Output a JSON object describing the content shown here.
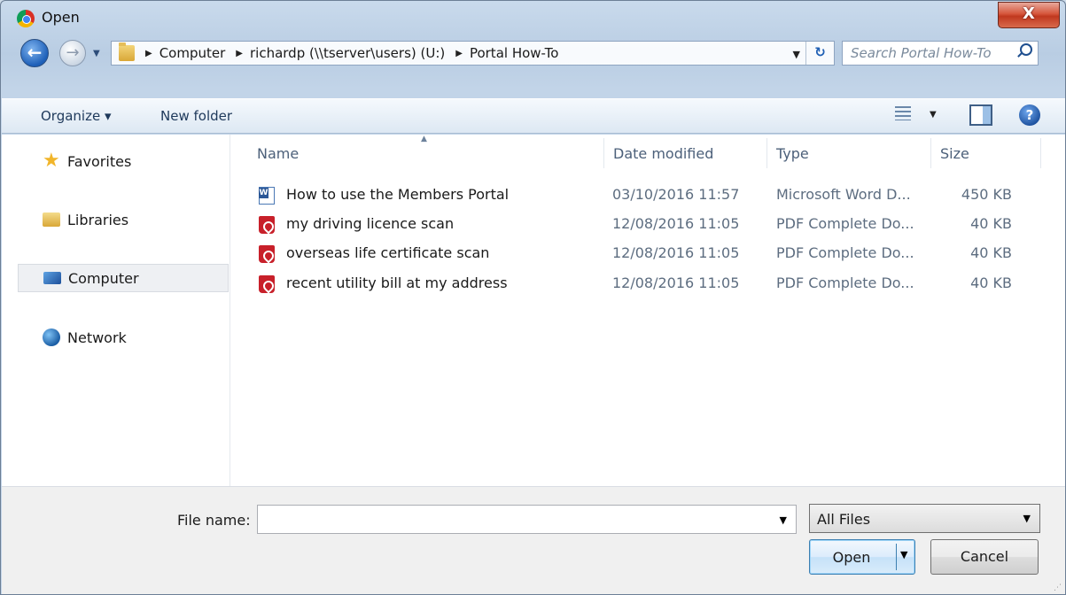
{
  "window": {
    "title": "Open",
    "close_label": "X"
  },
  "navigation": {
    "back_label": "←",
    "forward_label": "→"
  },
  "address": {
    "crumbs": [
      "Computer",
      "richardp (\\\\tserver\\users) (U:)",
      "Portal How-To"
    ],
    "refresh_label": "↻"
  },
  "search": {
    "placeholder": "Search Portal How-To"
  },
  "toolbar": {
    "organize_label": "Organize ▾",
    "new_folder_label": "New folder",
    "help_label": "?"
  },
  "sidebar": {
    "items": [
      {
        "label": "Favorites",
        "icon": "star-icon"
      },
      {
        "label": "Libraries",
        "icon": "libraries-icon"
      },
      {
        "label": "Computer",
        "icon": "computer-icon",
        "selected": true
      },
      {
        "label": "Network",
        "icon": "network-icon"
      }
    ]
  },
  "files": {
    "columns": [
      "Name",
      "Date modified",
      "Type",
      "Size"
    ],
    "sort_indicator": "▲",
    "rows": [
      {
        "name": "How to use the Members Portal",
        "date": "03/10/2016 11:57",
        "type": "Microsoft Word D...",
        "size": "450 KB",
        "icon": "word-document-icon"
      },
      {
        "name": "my driving licence scan",
        "date": "12/08/2016 11:05",
        "type": "PDF Complete Do...",
        "size": "40 KB",
        "icon": "pdf-document-icon"
      },
      {
        "name": "overseas life certificate scan",
        "date": "12/08/2016 11:05",
        "type": "PDF Complete Do...",
        "size": "40 KB",
        "icon": "pdf-document-icon"
      },
      {
        "name": "recent utility bill at my address",
        "date": "12/08/2016 11:05",
        "type": "PDF Complete Do...",
        "size": "40 KB",
        "icon": "pdf-document-icon"
      }
    ]
  },
  "footer": {
    "file_name_label": "File name:",
    "file_name_value": "",
    "filter_value": "All Files",
    "open_label": "Open",
    "cancel_label": "Cancel"
  },
  "colors": {
    "frame": "#c9daec",
    "close_button": "#c0381f",
    "accent": "#3c7fb1"
  }
}
